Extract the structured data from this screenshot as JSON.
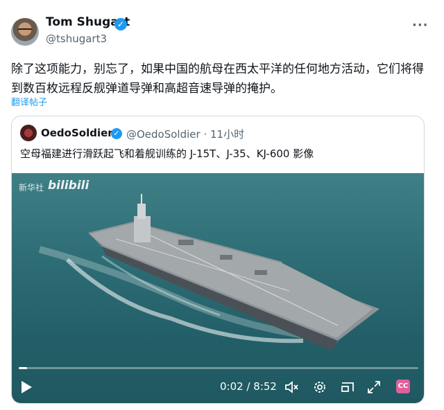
{
  "tweet": {
    "author_name": "Tom Shugart",
    "author_handle": "@tshugart3",
    "more_label": "···",
    "text": "除了这项能力，别忘了，如果中国的航母在西太平洋的任何地方活动，它们将得到数百枚远程反舰弹道导弹和高超音速导弹的掩护。",
    "translate_label": "翻译帖子"
  },
  "quote": {
    "author_name": "OedoSoldier",
    "author_handle": "@OedoSoldier · 11小时",
    "text": "空母福建进行滑跃起飞和着舰训练的 J-15T、J-35、KJ-600 影像"
  },
  "video": {
    "watermark_source": "新华社",
    "watermark_brand": "bilibili",
    "time_label": "0:02 / 8:52",
    "progress": 0.004,
    "caption_badge": "CC"
  },
  "colors": {
    "accent": "#1d9bf0",
    "secondary_text": "#536471",
    "border": "#cfd9de"
  },
  "icons": [
    "verified-icon",
    "more-icon",
    "play-icon",
    "volume-mute-icon",
    "settings-icon",
    "picture-in-picture-icon",
    "fullscreen-icon",
    "captions-icon"
  ]
}
